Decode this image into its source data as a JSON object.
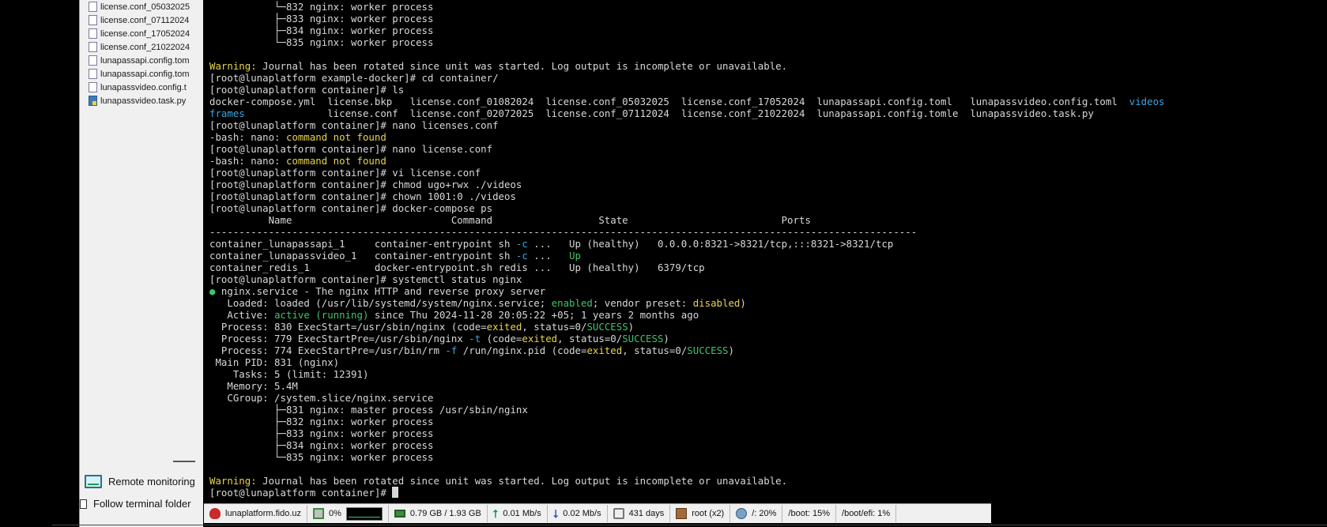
{
  "file_panel": {
    "files": [
      {
        "name": "license.conf_05032025",
        "type": "file"
      },
      {
        "name": "license.conf_07112024",
        "type": "file"
      },
      {
        "name": "license.conf_17052024",
        "type": "file"
      },
      {
        "name": "license.conf_21022024",
        "type": "file"
      },
      {
        "name": "lunapassapi.config.tom",
        "type": "file"
      },
      {
        "name": "lunapassapi.config.tom",
        "type": "file"
      },
      {
        "name": "lunapassvideo.config.t",
        "type": "file"
      },
      {
        "name": "lunapassvideo.task.py",
        "type": "python"
      }
    ],
    "remote_monitoring_label": "Remote monitoring",
    "follow_folder_label": "Follow terminal folder"
  },
  "terminal": {
    "lines": [
      [
        [
          "           └─832 nginx: worker process",
          ""
        ]
      ],
      [
        [
          "           ├─833 nginx: worker process",
          ""
        ]
      ],
      [
        [
          "           ├─834 nginx: worker process",
          ""
        ]
      ],
      [
        [
          "           └─835 nginx: worker process",
          ""
        ]
      ],
      [],
      [
        [
          "Warning:",
          "y"
        ],
        [
          " Journal has been rotated since unit was started. Log output is incomplete or unavailable.",
          ""
        ]
      ],
      [
        [
          "[root@lunaplatform example-docker]# cd container/",
          ""
        ]
      ],
      [
        [
          "[root@lunaplatform container]# ls",
          ""
        ]
      ],
      [
        [
          "docker-compose.yml  license.bkp   license.conf_01082024  license.conf_05032025  license.conf_17052024  lunapassapi.config.toml   lunapassvideo.config.toml  ",
          ""
        ],
        [
          "videos",
          "c"
        ]
      ],
      [
        [
          "frames",
          "c"
        ],
        [
          "              license.conf  license.conf_02072025  license.conf_07112024  license.conf_21022024  lunapassapi.config.tomle  lunapassvideo.task.py",
          ""
        ]
      ],
      [
        [
          "[root@lunaplatform container]# nano licenses.conf",
          ""
        ]
      ],
      [
        [
          "-bash: nano: ",
          ""
        ],
        [
          "command not found",
          "y"
        ]
      ],
      [
        [
          "[root@lunaplatform container]# nano license.conf",
          ""
        ]
      ],
      [
        [
          "-bash: nano: ",
          ""
        ],
        [
          "command not found",
          "y"
        ]
      ],
      [
        [
          "[root@lunaplatform container]# vi license.conf",
          ""
        ]
      ],
      [
        [
          "[root@lunaplatform container]# chmod ugo+rwx ./videos",
          ""
        ]
      ],
      [
        [
          "[root@lunaplatform container]# chown 1001:0 ./videos",
          ""
        ]
      ],
      [
        [
          "[root@lunaplatform container]# docker-compose ps",
          ""
        ]
      ],
      [
        [
          "          Name                           Command                  State                          Ports",
          ""
        ]
      ],
      [
        [
          "------------------------------------------------------------------------------------------------------------------------",
          ""
        ]
      ],
      [
        [
          "container_lunapassapi_1     container-entrypoint sh ",
          ""
        ],
        [
          "-c",
          "c"
        ],
        [
          " ...   Up (healthy)   0.0.0.0:8321->8321/tcp,:::8321->8321/tcp",
          ""
        ]
      ],
      [
        [
          "container_lunapassvideo_1   container-entrypoint sh ",
          ""
        ],
        [
          "-c",
          "c"
        ],
        [
          " ...   ",
          ""
        ],
        [
          "Up",
          "g"
        ]
      ],
      [
        [
          "container_redis_1           docker-entrypoint.sh redis ...   Up (healthy)   6379/tcp",
          ""
        ]
      ],
      [
        [
          "[root@lunaplatform container]# systemctl status nginx",
          ""
        ]
      ],
      [
        [
          "●",
          "g"
        ],
        [
          " nginx.service - The nginx HTTP and reverse proxy server",
          ""
        ]
      ],
      [
        [
          "   Loaded: loaded (/usr/lib/systemd/system/nginx.service; ",
          ""
        ],
        [
          "enabled",
          "g"
        ],
        [
          "; vendor preset: ",
          ""
        ],
        [
          "disabled",
          "y"
        ],
        [
          ")",
          ""
        ]
      ],
      [
        [
          "   Active: ",
          ""
        ],
        [
          "active (running)",
          "g"
        ],
        [
          " since Thu 2024-11-28 20:05:22 +05; 1 years 2 months ago",
          ""
        ]
      ],
      [
        [
          "  Process: 830 ExecStart=/usr/sbin/nginx (code=",
          ""
        ],
        [
          "exited",
          "y"
        ],
        [
          ", status=0/",
          ""
        ],
        [
          "SUCCESS",
          "g"
        ],
        [
          ")",
          ""
        ]
      ],
      [
        [
          "  Process: 779 ExecStartPre=/usr/sbin/nginx ",
          ""
        ],
        [
          "-t",
          "c"
        ],
        [
          " (code=",
          ""
        ],
        [
          "exited",
          "y"
        ],
        [
          ", status=0/",
          ""
        ],
        [
          "SUCCESS",
          "g"
        ],
        [
          ")",
          ""
        ]
      ],
      [
        [
          "  Process: 774 ExecStartPre=/usr/bin/rm ",
          ""
        ],
        [
          "-f",
          "c"
        ],
        [
          " /run/nginx.pid (code=",
          ""
        ],
        [
          "exited",
          "y"
        ],
        [
          ", status=0/",
          ""
        ],
        [
          "SUCCESS",
          "g"
        ],
        [
          ")",
          ""
        ]
      ],
      [
        [
          " Main PID: 831 (nginx)",
          ""
        ]
      ],
      [
        [
          "    Tasks: 5 (limit: 12391)",
          ""
        ]
      ],
      [
        [
          "   Memory: 5.4M",
          ""
        ]
      ],
      [
        [
          "   CGroup: /system.slice/nginx.service",
          ""
        ]
      ],
      [
        [
          "           ├─831 nginx: master process /usr/sbin/nginx",
          ""
        ]
      ],
      [
        [
          "           ├─832 nginx: worker process",
          ""
        ]
      ],
      [
        [
          "           ├─833 nginx: worker process",
          ""
        ]
      ],
      [
        [
          "           ├─834 nginx: worker process",
          ""
        ]
      ],
      [
        [
          "           └─835 nginx: worker process",
          ""
        ]
      ],
      [],
      [
        [
          "Warning:",
          "y"
        ],
        [
          " Journal has been rotated since unit was started. Log output is incomplete or unavailable.",
          ""
        ]
      ],
      [
        [
          "[root@lunaplatform container]# ",
          ""
        ]
      ]
    ]
  },
  "status_bar": {
    "host": "lunaplatform.fido.uz",
    "cpu": "0%",
    "memory": "0.79 GB / 1.93 GB",
    "upload": "0.01 Mb/s",
    "download": "0.02 Mb/s",
    "uptime": "431 days",
    "user": "root (x2)",
    "disk_root": "/: 20%",
    "disk_boot": "/boot: 15%",
    "disk_boot_efi": "/boot/efi: 1%"
  }
}
